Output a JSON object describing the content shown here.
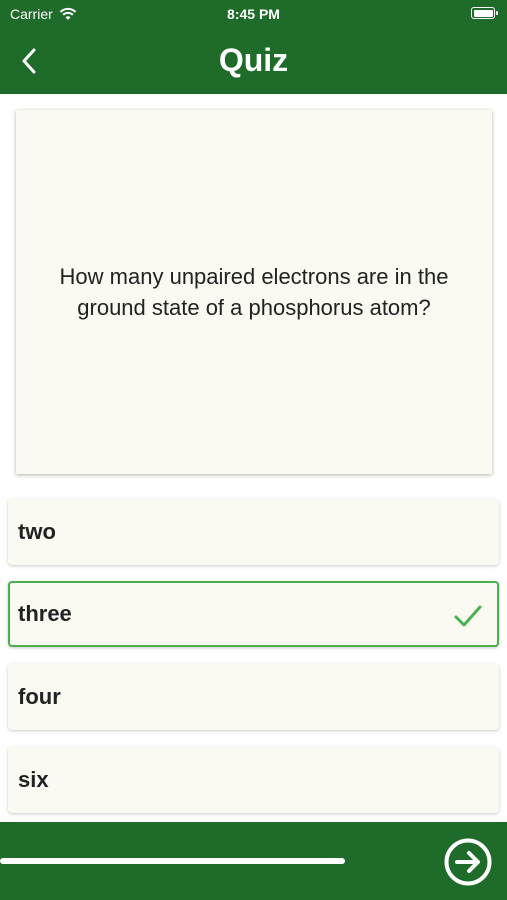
{
  "status_bar": {
    "carrier": "Carrier",
    "time": "8:45 PM"
  },
  "nav": {
    "title": "Quiz"
  },
  "question": {
    "text": "How many unpaired electrons are in the ground state of a phosphorus atom?"
  },
  "answers": [
    {
      "label": "two",
      "selected": false
    },
    {
      "label": "three",
      "selected": true
    },
    {
      "label": "four",
      "selected": false
    },
    {
      "label": "six",
      "selected": false
    }
  ],
  "progress": {
    "fraction": 0.68
  },
  "colors": {
    "brand_green": "#1e6b2a",
    "selected_green": "#4caf50",
    "card_background": "#fafaf2"
  },
  "icons": {
    "back": "chevron-left-icon",
    "check": "checkmark-icon",
    "next": "arrow-right-circle-icon",
    "wifi": "wifi-icon",
    "battery": "battery-icon"
  }
}
